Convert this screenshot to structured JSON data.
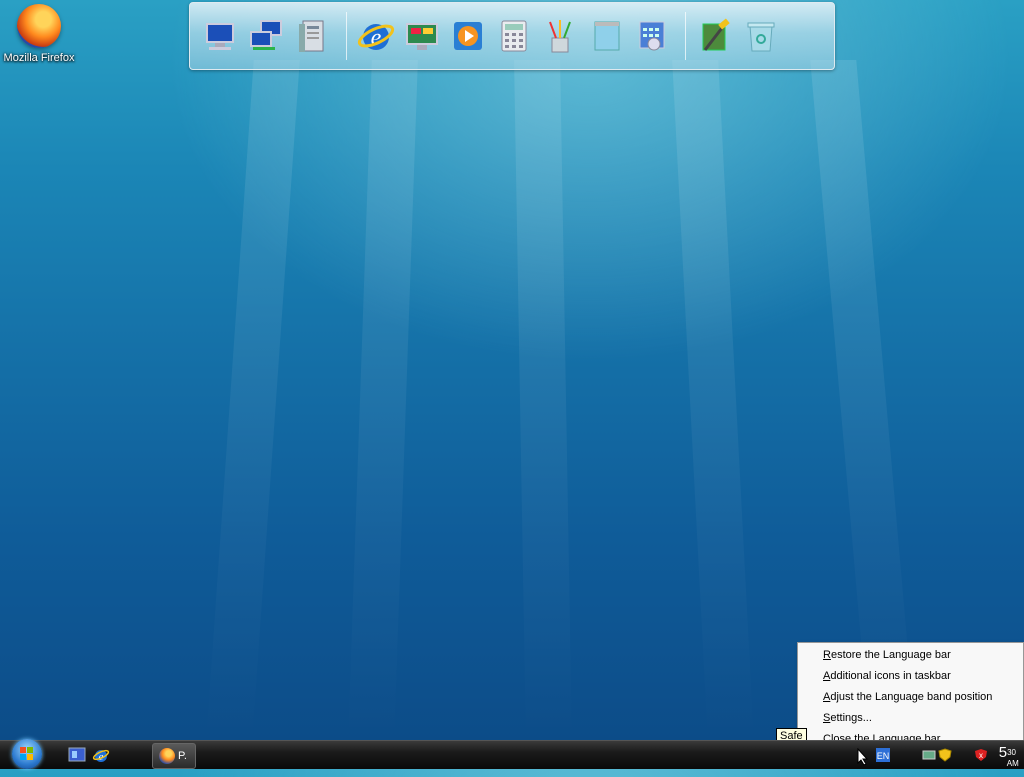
{
  "desktop": {
    "icons": [
      {
        "label": "Mozilla Firefox",
        "icon": "firefox-icon"
      }
    ]
  },
  "dock": {
    "items": [
      "computer-icon",
      "network-icon",
      "documents-icon",
      "internet-explorer-icon",
      "control-panel-icon",
      "media-player-icon",
      "calculator-icon",
      "paint-icon",
      "notepad-icon",
      "calendar-icon",
      "tools-icon",
      "recycle-bin-icon"
    ]
  },
  "taskbar": {
    "start_icon": "windows-start-orb",
    "quick_launch": [
      "show-desktop-icon",
      "internet-explorer-icon"
    ],
    "task_button_label": "P.",
    "clock": {
      "hour": "5",
      "minute": "30",
      "ampm": "AM"
    }
  },
  "tooltip": {
    "text": "Safe"
  },
  "context_menu": {
    "items": [
      {
        "mnemonic": "R",
        "rest": "estore the Language bar"
      },
      {
        "mnemonic": "A",
        "rest": "dditional icons in taskbar"
      },
      {
        "mnemonic": "A",
        "rest": "djust the Language band position"
      },
      {
        "mnemonic": "S",
        "rest": "ettings..."
      },
      {
        "mnemonic": "C",
        "rest": "lose the Language bar"
      }
    ]
  },
  "colors": {
    "desktop_top": "#2aa0c4",
    "desktop_bottom": "#0c4a86",
    "taskbar": "#1a1a1a",
    "menu_bg": "#f8f8f8"
  }
}
